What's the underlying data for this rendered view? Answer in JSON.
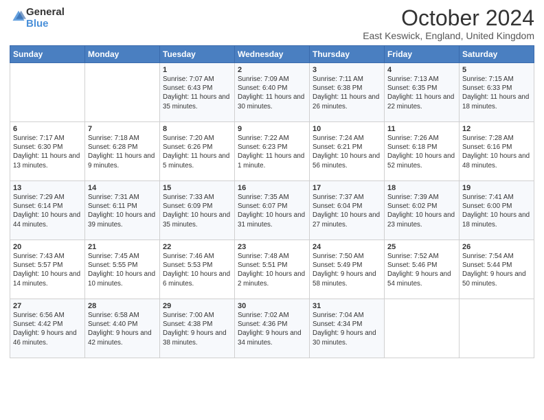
{
  "header": {
    "logo_line1": "General",
    "logo_line2": "Blue",
    "month_title": "October 2024",
    "location": "East Keswick, England, United Kingdom"
  },
  "weekdays": [
    "Sunday",
    "Monday",
    "Tuesday",
    "Wednesday",
    "Thursday",
    "Friday",
    "Saturday"
  ],
  "weeks": [
    [
      {
        "day": "",
        "info": ""
      },
      {
        "day": "",
        "info": ""
      },
      {
        "day": "1",
        "info": "Sunrise: 7:07 AM\nSunset: 6:43 PM\nDaylight: 11 hours and 35 minutes."
      },
      {
        "day": "2",
        "info": "Sunrise: 7:09 AM\nSunset: 6:40 PM\nDaylight: 11 hours and 30 minutes."
      },
      {
        "day": "3",
        "info": "Sunrise: 7:11 AM\nSunset: 6:38 PM\nDaylight: 11 hours and 26 minutes."
      },
      {
        "day": "4",
        "info": "Sunrise: 7:13 AM\nSunset: 6:35 PM\nDaylight: 11 hours and 22 minutes."
      },
      {
        "day": "5",
        "info": "Sunrise: 7:15 AM\nSunset: 6:33 PM\nDaylight: 11 hours and 18 minutes."
      }
    ],
    [
      {
        "day": "6",
        "info": "Sunrise: 7:17 AM\nSunset: 6:30 PM\nDaylight: 11 hours and 13 minutes."
      },
      {
        "day": "7",
        "info": "Sunrise: 7:18 AM\nSunset: 6:28 PM\nDaylight: 11 hours and 9 minutes."
      },
      {
        "day": "8",
        "info": "Sunrise: 7:20 AM\nSunset: 6:26 PM\nDaylight: 11 hours and 5 minutes."
      },
      {
        "day": "9",
        "info": "Sunrise: 7:22 AM\nSunset: 6:23 PM\nDaylight: 11 hours and 1 minute."
      },
      {
        "day": "10",
        "info": "Sunrise: 7:24 AM\nSunset: 6:21 PM\nDaylight: 10 hours and 56 minutes."
      },
      {
        "day": "11",
        "info": "Sunrise: 7:26 AM\nSunset: 6:18 PM\nDaylight: 10 hours and 52 minutes."
      },
      {
        "day": "12",
        "info": "Sunrise: 7:28 AM\nSunset: 6:16 PM\nDaylight: 10 hours and 48 minutes."
      }
    ],
    [
      {
        "day": "13",
        "info": "Sunrise: 7:29 AM\nSunset: 6:14 PM\nDaylight: 10 hours and 44 minutes."
      },
      {
        "day": "14",
        "info": "Sunrise: 7:31 AM\nSunset: 6:11 PM\nDaylight: 10 hours and 39 minutes."
      },
      {
        "day": "15",
        "info": "Sunrise: 7:33 AM\nSunset: 6:09 PM\nDaylight: 10 hours and 35 minutes."
      },
      {
        "day": "16",
        "info": "Sunrise: 7:35 AM\nSunset: 6:07 PM\nDaylight: 10 hours and 31 minutes."
      },
      {
        "day": "17",
        "info": "Sunrise: 7:37 AM\nSunset: 6:04 PM\nDaylight: 10 hours and 27 minutes."
      },
      {
        "day": "18",
        "info": "Sunrise: 7:39 AM\nSunset: 6:02 PM\nDaylight: 10 hours and 23 minutes."
      },
      {
        "day": "19",
        "info": "Sunrise: 7:41 AM\nSunset: 6:00 PM\nDaylight: 10 hours and 18 minutes."
      }
    ],
    [
      {
        "day": "20",
        "info": "Sunrise: 7:43 AM\nSunset: 5:57 PM\nDaylight: 10 hours and 14 minutes."
      },
      {
        "day": "21",
        "info": "Sunrise: 7:45 AM\nSunset: 5:55 PM\nDaylight: 10 hours and 10 minutes."
      },
      {
        "day": "22",
        "info": "Sunrise: 7:46 AM\nSunset: 5:53 PM\nDaylight: 10 hours and 6 minutes."
      },
      {
        "day": "23",
        "info": "Sunrise: 7:48 AM\nSunset: 5:51 PM\nDaylight: 10 hours and 2 minutes."
      },
      {
        "day": "24",
        "info": "Sunrise: 7:50 AM\nSunset: 5:49 PM\nDaylight: 9 hours and 58 minutes."
      },
      {
        "day": "25",
        "info": "Sunrise: 7:52 AM\nSunset: 5:46 PM\nDaylight: 9 hours and 54 minutes."
      },
      {
        "day": "26",
        "info": "Sunrise: 7:54 AM\nSunset: 5:44 PM\nDaylight: 9 hours and 50 minutes."
      }
    ],
    [
      {
        "day": "27",
        "info": "Sunrise: 6:56 AM\nSunset: 4:42 PM\nDaylight: 9 hours and 46 minutes."
      },
      {
        "day": "28",
        "info": "Sunrise: 6:58 AM\nSunset: 4:40 PM\nDaylight: 9 hours and 42 minutes."
      },
      {
        "day": "29",
        "info": "Sunrise: 7:00 AM\nSunset: 4:38 PM\nDaylight: 9 hours and 38 minutes."
      },
      {
        "day": "30",
        "info": "Sunrise: 7:02 AM\nSunset: 4:36 PM\nDaylight: 9 hours and 34 minutes."
      },
      {
        "day": "31",
        "info": "Sunrise: 7:04 AM\nSunset: 4:34 PM\nDaylight: 9 hours and 30 minutes."
      },
      {
        "day": "",
        "info": ""
      },
      {
        "day": "",
        "info": ""
      }
    ]
  ]
}
